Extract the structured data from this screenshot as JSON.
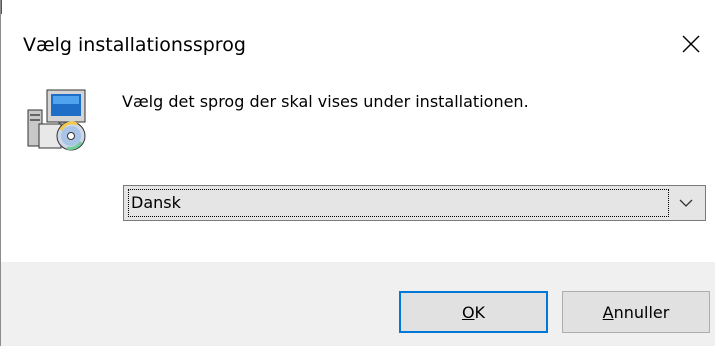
{
  "dialog": {
    "title": "Vælg installationssprog",
    "prompt": "Vælg det sprog der skal vises under installationen.",
    "close_glyph": "✕"
  },
  "icons": {
    "setup": "setup-computer-cd-icon",
    "close": "close-icon",
    "dropdown": "chevron-down-icon"
  },
  "language_select": {
    "value": "Dansk"
  },
  "buttons": {
    "ok": {
      "accel": "O",
      "rest": "K"
    },
    "cancel": {
      "accel": "A",
      "rest": "nnuller"
    }
  },
  "colors": {
    "focus_border": "#0078d7",
    "footer_bg": "#f0f0f0",
    "button_bg": "#e1e1e1"
  }
}
